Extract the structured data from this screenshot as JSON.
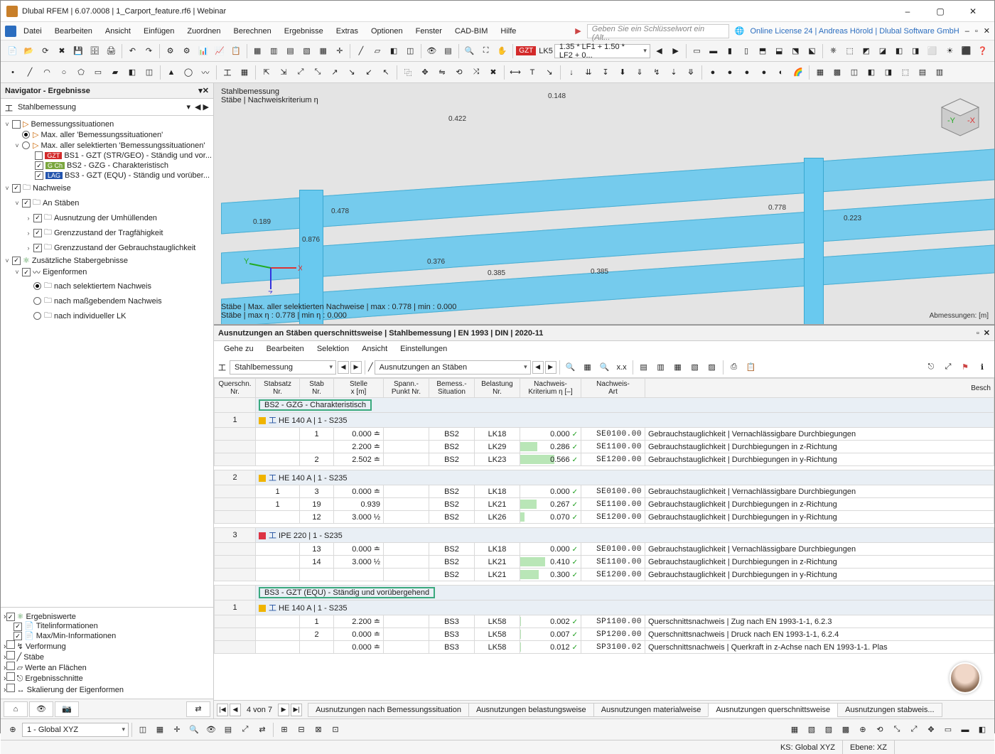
{
  "window": {
    "title": "Dlubal RFEM | 6.07.0008 | 1_Carport_feature.rf6 | Webinar",
    "minimize": "–",
    "maximize": "▢",
    "close": "✕"
  },
  "menubar": {
    "items": [
      "Datei",
      "Bearbeiten",
      "Ansicht",
      "Einfügen",
      "Zuordnen",
      "Berechnen",
      "Ergebnisse",
      "Extras",
      "Optionen",
      "Fenster",
      "CAD-BIM",
      "Hilfe"
    ],
    "search_placeholder": "Geben Sie ein Schlüsselwort ein (Alt...",
    "license": "Online License 24 | Andreas Hörold | Dlubal Software GmbH"
  },
  "toolbar2": {
    "gzt": "GZT",
    "lk": "LK5",
    "combo": "1.35 * LF1 + 1.50 * LF2 + 0..."
  },
  "nav": {
    "title": "Navigator - Ergebnisse",
    "section": "Stahlbemessung",
    "root": "Bemessungssituationen",
    "r1": "Max. aller 'Bemessungssituationen'",
    "r2": "Max. aller selektierten 'Bemessungssituationen'",
    "bs1": "BS1 - GZT (STR/GEO) - Ständig und vor...",
    "bs2": "BS2 - GZG - Charakteristisch",
    "bs3": "BS3 - GZT (EQU) - Ständig und vorüber...",
    "nachweise": "Nachweise",
    "anstab": "An Stäben",
    "umh": "Ausnutzung der Umhüllenden",
    "gtf": "Grenzzustand der Tragfähigkeit",
    "gbt": "Grenzzustand der Gebrauchstauglichkeit",
    "zus": "Zusätzliche Stabergebnisse",
    "eig": "Eigenformen",
    "e1": "nach selektiertem Nachweis",
    "e2": "nach maßgebendem Nachweis",
    "e3": "nach individueller LK",
    "chk": {
      "ew": "Ergebniswerte",
      "ti": "Titelinformationen",
      "mm": "Max/Min-Informationen",
      "vf": "Verformung",
      "st": "Stäbe",
      "wf": "Werte an Flächen",
      "es": "Ergebnisschnitte",
      "se": "Skalierung der Eigenformen"
    }
  },
  "viewport": {
    "title": "Stahlbemessung",
    "sub": "Stäbe | Nachweiskriterium η",
    "vals": {
      "a": "0.148",
      "b": "0.422",
      "c": "0.778",
      "d": "0.189",
      "e": "0.478",
      "f": "0.376",
      "g": "0.385",
      "h": "0.385",
      "i": "0.223",
      "j": "0.876"
    },
    "summary1": "Stäbe | Max. aller selektierten Nachweise | max  : 0.778 | min  : 0.000",
    "summary2": "Stäbe | max η : 0.778 | min η : 0.000",
    "dimlabel": "Abmessungen: [m]"
  },
  "table": {
    "title": "Ausnutzungen an Stäben querschnittsweise | Stahlbemessung | EN 1993 | DIN | 2020-11",
    "menu": [
      "Gehe zu",
      "Bearbeiten",
      "Selektion",
      "Ansicht",
      "Einstellungen"
    ],
    "combo1": "Stahlbemessung",
    "combo2": "Ausnutzungen an Stäben",
    "hdr": {
      "q": "Querschn.\nNr.",
      "ss": "Stabsatz\nNr.",
      "st": "Stab\nNr.",
      "x": "Stelle\nx [m]",
      "sp": "Spann.-\nPunkt Nr.",
      "bs": "Bemess.-\nSituation",
      "lk": "Belastung\nNr.",
      "eta": "Nachweis-\nKriterium η [–]",
      "code": "Nachweis-\nArt",
      "desc": "Besch"
    },
    "grp1": "BS2 - GZG - Charakteristisch",
    "sec1": "HE 140 A | 1 - S235",
    "sec2": "HE 140 A | 1 - S235",
    "sec3": "IPE 220 | 1 - S235",
    "grp2": "BS3 - GZT (EQU) - Ständig und vorübergehend",
    "sec4": "HE 140 A | 1 - S235",
    "rows1": [
      {
        "ss": "",
        "st": "1",
        "x": "0.000 ≐",
        "sp": "",
        "bs": "BS2",
        "lk": "LK18",
        "eta": "0.000",
        "code": "SE0100.00",
        "d": "Gebrauchstauglichkeit | Vernachlässigbare Durchbiegungen"
      },
      {
        "ss": "",
        "st": "",
        "x": "2.200 ≐",
        "sp": "",
        "bs": "BS2",
        "lk": "LK29",
        "eta": "0.286",
        "code": "SE1100.00",
        "d": "Gebrauchstauglichkeit | Durchbiegungen in z-Richtung"
      },
      {
        "ss": "",
        "st": "2",
        "x": "2.502 ≐",
        "sp": "",
        "bs": "BS2",
        "lk": "LK23",
        "eta": "0.566",
        "code": "SE1200.00",
        "d": "Gebrauchstauglichkeit | Durchbiegungen in y-Richtung"
      }
    ],
    "rows2": [
      {
        "ss": "1",
        "st": "3",
        "x": "0.000 ≐",
        "sp": "",
        "bs": "BS2",
        "lk": "LK18",
        "eta": "0.000",
        "code": "SE0100.00",
        "d": "Gebrauchstauglichkeit | Vernachlässigbare Durchbiegungen"
      },
      {
        "ss": "1",
        "st": "19",
        "x": "0.939",
        "sp": "",
        "bs": "BS2",
        "lk": "LK21",
        "eta": "0.267",
        "code": "SE1100.00",
        "d": "Gebrauchstauglichkeit | Durchbiegungen in z-Richtung"
      },
      {
        "ss": "",
        "st": "12",
        "x": "3.000 ½",
        "sp": "",
        "bs": "BS2",
        "lk": "LK26",
        "eta": "0.070",
        "code": "SE1200.00",
        "d": "Gebrauchstauglichkeit | Durchbiegungen in y-Richtung"
      }
    ],
    "rows3": [
      {
        "ss": "",
        "st": "13",
        "x": "0.000 ≐",
        "sp": "",
        "bs": "BS2",
        "lk": "LK18",
        "eta": "0.000",
        "code": "SE0100.00",
        "d": "Gebrauchstauglichkeit | Vernachlässigbare Durchbiegungen"
      },
      {
        "ss": "",
        "st": "14",
        "x": "3.000 ½",
        "sp": "",
        "bs": "BS2",
        "lk": "LK21",
        "eta": "0.410",
        "code": "SE1100.00",
        "d": "Gebrauchstauglichkeit | Durchbiegungen in z-Richtung"
      },
      {
        "ss": "",
        "st": "",
        "x": "",
        "sp": "",
        "bs": "BS2",
        "lk": "LK21",
        "eta": "0.300",
        "code": "SE1200.00",
        "d": "Gebrauchstauglichkeit | Durchbiegungen in y-Richtung"
      }
    ],
    "rows4": [
      {
        "ss": "",
        "st": "1",
        "x": "2.200 ≐",
        "sp": "",
        "bs": "BS3",
        "lk": "LK58",
        "eta": "0.002",
        "code": "SP1100.00",
        "d": "Querschnittsnachweis | Zug nach EN 1993-1-1, 6.2.3"
      },
      {
        "ss": "",
        "st": "2",
        "x": "0.000 ≐",
        "sp": "",
        "bs": "BS3",
        "lk": "LK58",
        "eta": "0.007",
        "code": "SP1200.00",
        "d": "Querschnittsnachweis | Druck nach EN 1993-1-1, 6.2.4"
      },
      {
        "ss": "",
        "st": "",
        "x": "0.000 ≐",
        "sp": "",
        "bs": "BS3",
        "lk": "LK58",
        "eta": "0.012",
        "code": "SP3100.02",
        "d": "Querschnittsnachweis | Querkraft in z-Achse nach EN 1993-1-1.      Plas"
      }
    ],
    "pager": "4 von 7",
    "tabs": [
      "Ausnutzungen nach Bemessungssituation",
      "Ausnutzungen belastungsweise",
      "Ausnutzungen materialweise",
      "Ausnutzungen querschnittsweise",
      "Ausnutzungen stabweis..."
    ]
  },
  "statusrow": {
    "cs": "1 - Global XYZ"
  },
  "status": {
    "ks": "KS: Global XYZ",
    "eb": "Ebene: XZ"
  }
}
